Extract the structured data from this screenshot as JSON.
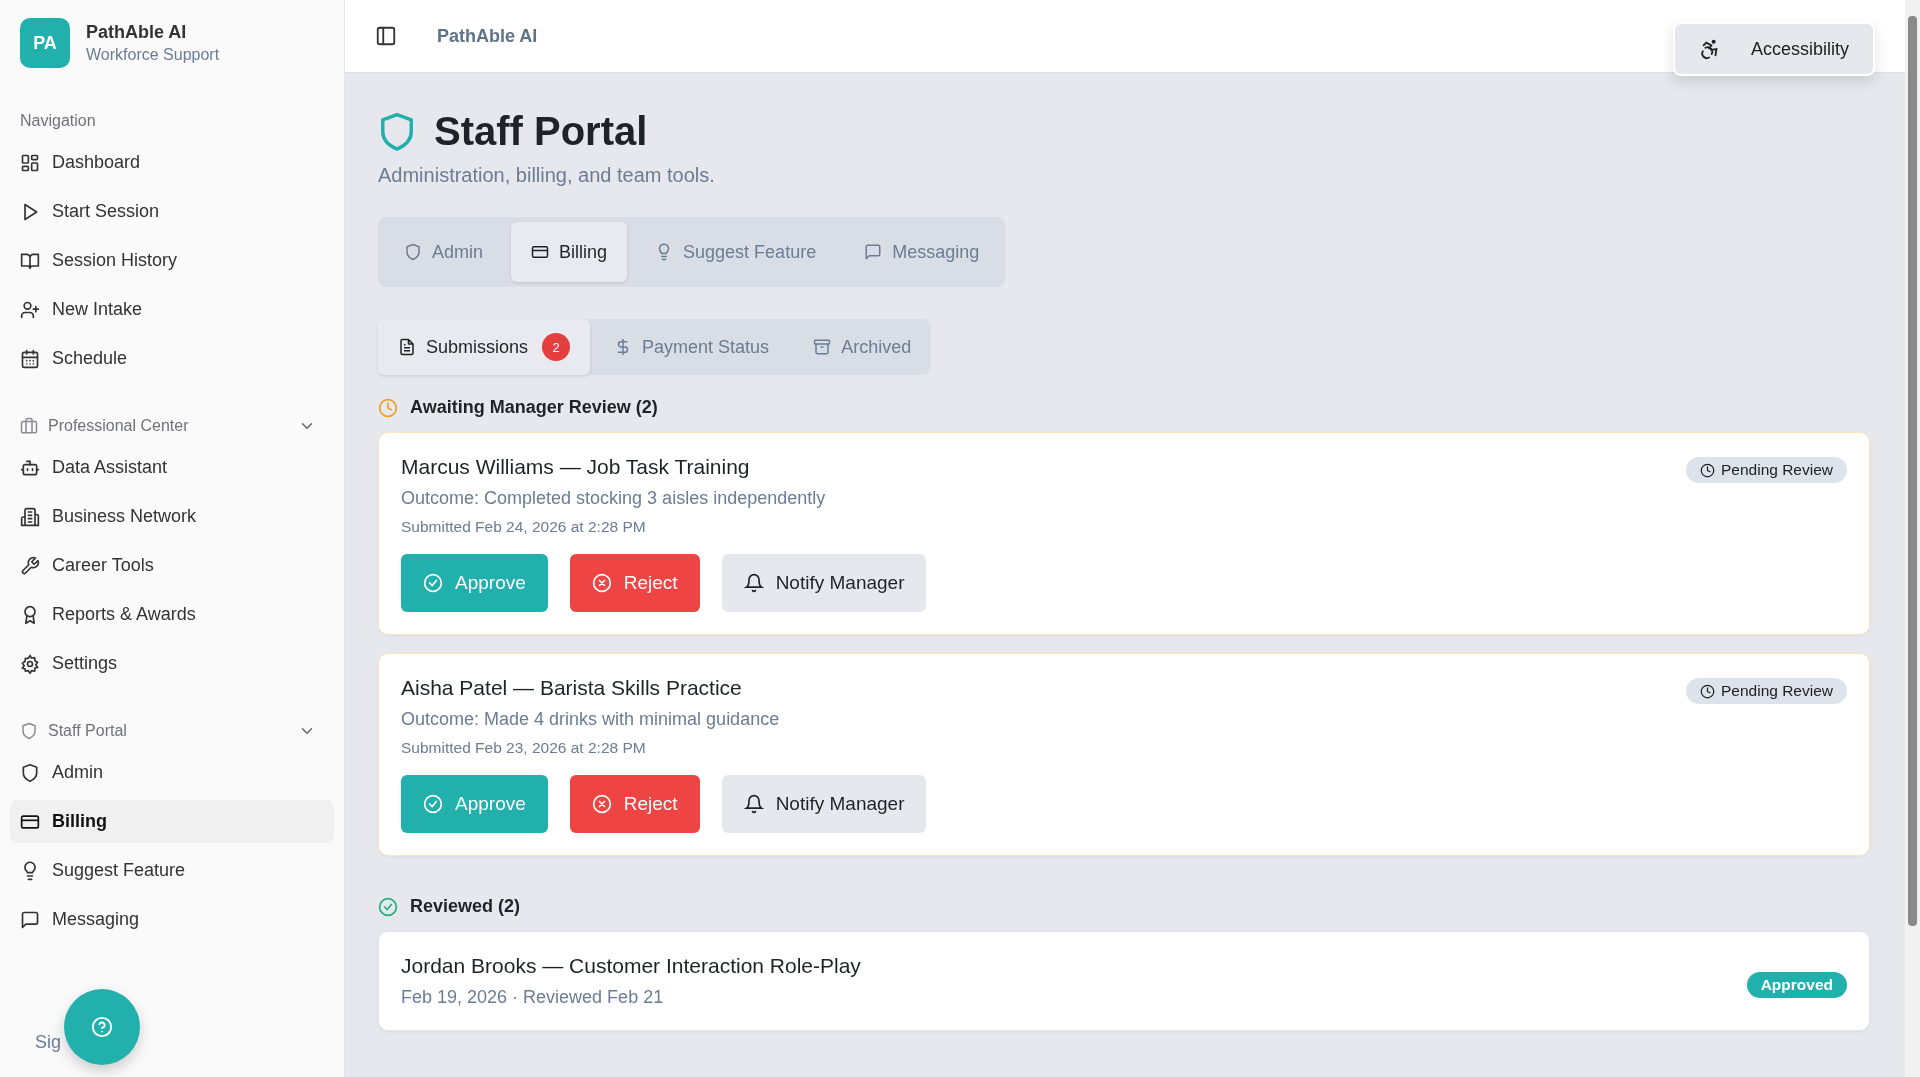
{
  "brand": {
    "logo": "PA",
    "name": "PathAble AI",
    "subtitle": "Workforce Support"
  },
  "sidebar": {
    "sections": [
      {
        "label": "Navigation",
        "kind": "plain",
        "items": [
          {
            "label": "Dashboard",
            "selected": false
          },
          {
            "label": "Start Session",
            "selected": false
          },
          {
            "label": "Session History",
            "selected": false
          },
          {
            "label": "New Intake",
            "selected": false
          },
          {
            "label": "Schedule",
            "selected": false
          }
        ]
      },
      {
        "label": "Professional Center",
        "kind": "group",
        "expanded": true,
        "items": [
          {
            "label": "Data Assistant",
            "selected": false
          },
          {
            "label": "Business Network",
            "selected": false
          },
          {
            "label": "Career Tools",
            "selected": false
          },
          {
            "label": "Reports & Awards",
            "selected": false
          },
          {
            "label": "Settings",
            "selected": false
          }
        ]
      },
      {
        "label": "Staff Portal",
        "kind": "group",
        "expanded": true,
        "items": [
          {
            "label": "Admin",
            "selected": false
          },
          {
            "label": "Billing",
            "selected": true
          },
          {
            "label": "Suggest Feature",
            "selected": false
          },
          {
            "label": "Messaging",
            "selected": false
          }
        ]
      }
    ],
    "sign_out": "Sig"
  },
  "header": {
    "title": "PathAble AI",
    "accessibility_button": "Accessibility"
  },
  "page": {
    "title": "Staff Portal",
    "subtitle": "Administration, billing, and team tools."
  },
  "tabs": [
    {
      "label": "Admin",
      "selected": false
    },
    {
      "label": "Billing",
      "selected": true
    },
    {
      "label": "Suggest Feature",
      "selected": false
    },
    {
      "label": "Messaging",
      "selected": false
    }
  ],
  "subtabs": [
    {
      "label": "Submissions",
      "selected": true,
      "badge": "2"
    },
    {
      "label": "Payment Status",
      "selected": false
    },
    {
      "label": "Archived",
      "selected": false
    }
  ],
  "sections": [
    {
      "heading": "Awaiting Manager Review (2)",
      "kind": "pending",
      "cards": [
        {
          "title": "Marcus Williams — Job Task Training",
          "outcome": "Outcome: Completed stocking 3 aisles independently",
          "meta": "Submitted Feb 24, 2026 at 2:28 PM",
          "status": {
            "label": "Pending Review",
            "kind": "pending"
          },
          "actions": [
            {
              "label": "Approve",
              "kind": "approve"
            },
            {
              "label": "Reject",
              "kind": "reject"
            },
            {
              "label": "Notify Manager",
              "kind": "notify"
            }
          ]
        },
        {
          "title": "Aisha Patel — Barista Skills Practice",
          "outcome": "Outcome: Made 4 drinks with minimal guidance",
          "meta": "Submitted Feb 23, 2026 at 2:28 PM",
          "status": {
            "label": "Pending Review",
            "kind": "pending"
          },
          "actions": [
            {
              "label": "Approve",
              "kind": "approve"
            },
            {
              "label": "Reject",
              "kind": "reject"
            },
            {
              "label": "Notify Manager",
              "kind": "notify"
            }
          ]
        }
      ]
    },
    {
      "heading": "Reviewed (2)",
      "kind": "reviewed",
      "cards": [
        {
          "title": "Jordan Brooks — Customer Interaction Role-Play",
          "meta": "Feb 19, 2026 · Reviewed Feb 21",
          "status": {
            "label": "Approved",
            "kind": "approved"
          }
        }
      ]
    }
  ]
}
